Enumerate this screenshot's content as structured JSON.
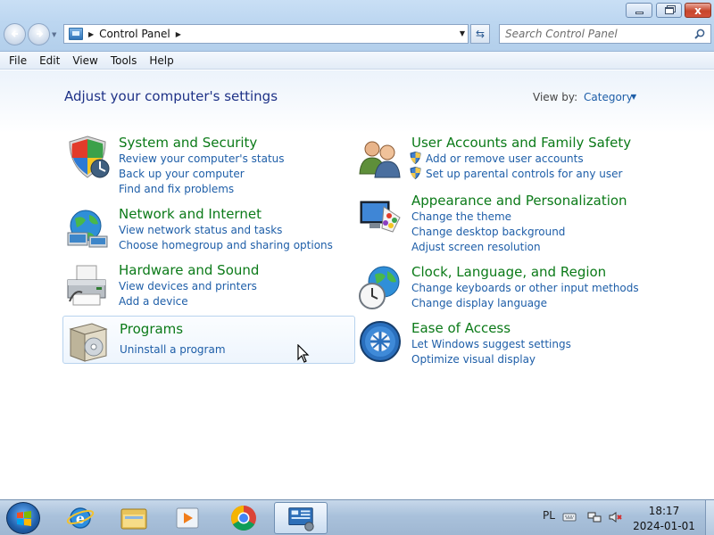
{
  "window": {
    "address_text": "Control Panel",
    "search_placeholder": "Search Control Panel",
    "close_glyph": "x"
  },
  "menubar": {
    "items": [
      "File",
      "Edit",
      "View",
      "Tools",
      "Help"
    ]
  },
  "page": {
    "title": "Adjust your computer's settings",
    "view_by_label": "View by:",
    "view_by_value": "Category"
  },
  "categories": {
    "system_security": {
      "title": "System and Security",
      "links": [
        "Review your computer's status",
        "Back up your computer",
        "Find and fix problems"
      ]
    },
    "network_internet": {
      "title": "Network and Internet",
      "links": [
        "View network status and tasks",
        "Choose homegroup and sharing options"
      ]
    },
    "hardware_sound": {
      "title": "Hardware and Sound",
      "links": [
        "View devices and printers",
        "Add a device"
      ]
    },
    "programs": {
      "title": "Programs",
      "links": [
        "Uninstall a program"
      ]
    },
    "user_accounts": {
      "title": "User Accounts and Family Safety",
      "links": [
        "Add or remove user accounts",
        "Set up parental controls for any user"
      ]
    },
    "appearance": {
      "title": "Appearance and Personalization",
      "links": [
        "Change the theme",
        "Change desktop background",
        "Adjust screen resolution"
      ]
    },
    "clock_region": {
      "title": "Clock, Language, and Region",
      "links": [
        "Change keyboards or other input methods",
        "Change display language"
      ]
    },
    "ease_access": {
      "title": "Ease of Access",
      "links": [
        "Let Windows suggest settings",
        "Optimize visual display"
      ]
    }
  },
  "taskbar": {
    "pinned": [
      "internet-explorer-icon",
      "windows-explorer-icon",
      "media-player-icon",
      "chrome-icon",
      "control-panel-icon"
    ],
    "tray_language": "PL",
    "clock_time": "18:17",
    "clock_date": "2024-01-01"
  },
  "colors": {
    "category_title": "#0b7a18",
    "link": "#1e5ea8",
    "page_title": "#1e3287"
  }
}
